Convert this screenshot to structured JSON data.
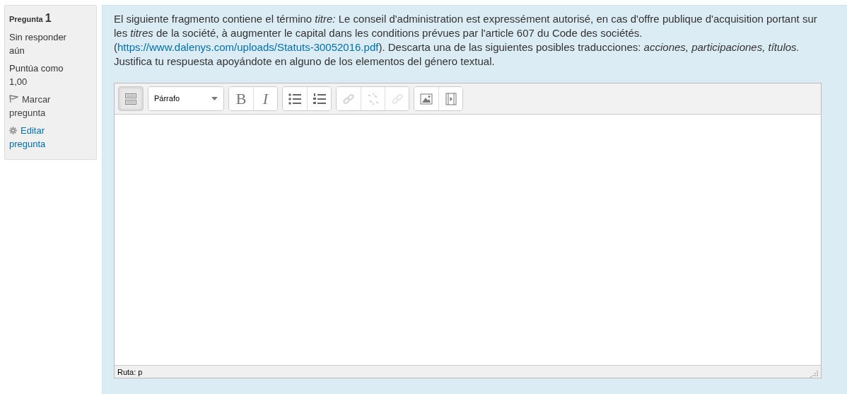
{
  "info": {
    "title": "Pregunta",
    "number": "1",
    "state": "Sin responder aún",
    "grade": "Puntúa como 1,00",
    "flag": {
      "label": "Marcar pregunta",
      "flagged": false
    },
    "edit": "Editar pregunta"
  },
  "question": {
    "before": "El siguiente fragmento contiene el término *titre:* Le conseil d'administration est expressément autorisé, en cas d'offre publique d'acquisition portant sur les *titres* de la société, à augmenter le capital dans les conditions prévues par l'article 607 du Code des sociétés. (",
    "link": "https://www.dalenys.com/uploads/Statuts-30052016.pdf",
    "after": "). Descarta una de las siguientes posibles traducciones: *acciones, participaciones, títulos.* Justifica tu respuesta apoyándote en alguno de los elementos del género textual."
  },
  "editor": {
    "toolbar": [
      [
        {
          "kind": "toggle",
          "disabled": false,
          "pressed": true
        }
      ],
      [
        {
          "kind": "format",
          "label": "Párrafo",
          "disabled": false
        }
      ],
      [
        {
          "kind": "bold",
          "label": "B",
          "disabled": false
        },
        {
          "kind": "italic",
          "label": "I",
          "disabled": false
        }
      ],
      [
        {
          "kind": "bullets",
          "disabled": false
        },
        {
          "kind": "numbers",
          "disabled": false
        }
      ],
      [
        {
          "kind": "link",
          "disabled": true
        },
        {
          "kind": "unlink",
          "disabled": true
        },
        {
          "kind": "anchor",
          "disabled": true
        }
      ],
      [
        {
          "kind": "image",
          "disabled": false
        },
        {
          "kind": "media",
          "disabled": false
        }
      ]
    ],
    "path": "Ruta: p"
  }
}
